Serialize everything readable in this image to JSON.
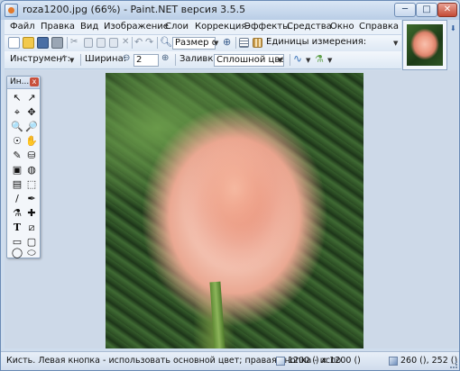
{
  "window": {
    "title": "roza1200.jpg (66%) - Paint.NET версия 3.5.5",
    "min_label": "─",
    "max_label": "□",
    "close_label": "✕"
  },
  "menu": {
    "items": [
      "Файл",
      "Правка",
      "Вид",
      "Изображение",
      "Слои",
      "Коррекция",
      "Эффекты",
      "Средства",
      "Окно",
      "Справка"
    ]
  },
  "toolbar": {
    "zoom_value": "Размер ог",
    "units_label": "Единицы измерения:",
    "tool_label": "Инструмент:",
    "width_label": "Ширина:",
    "width_value": "2",
    "fill_label": "Заливка:",
    "fill_value": "Сплошной цвет"
  },
  "tools_window": {
    "title": "Ин...",
    "close_label": "x",
    "tools": [
      "↖",
      "↗",
      "⌖",
      "✥",
      "🔍",
      "🔎",
      "☉",
      "✋",
      "✎",
      "⛁",
      "▣",
      "◍",
      "▤",
      "⬚",
      "/",
      "✒",
      "⚗",
      "✚",
      "T",
      "⧄",
      "▭",
      "▢",
      "◯",
      "⬭"
    ]
  },
  "status": {
    "hint": "Кисть. Левая кнопка - использовать основной цвет; правая кнопка - испо",
    "image_size": "1200 () x 1200 ()",
    "cursor_pos": "260 (), 252 ()"
  }
}
